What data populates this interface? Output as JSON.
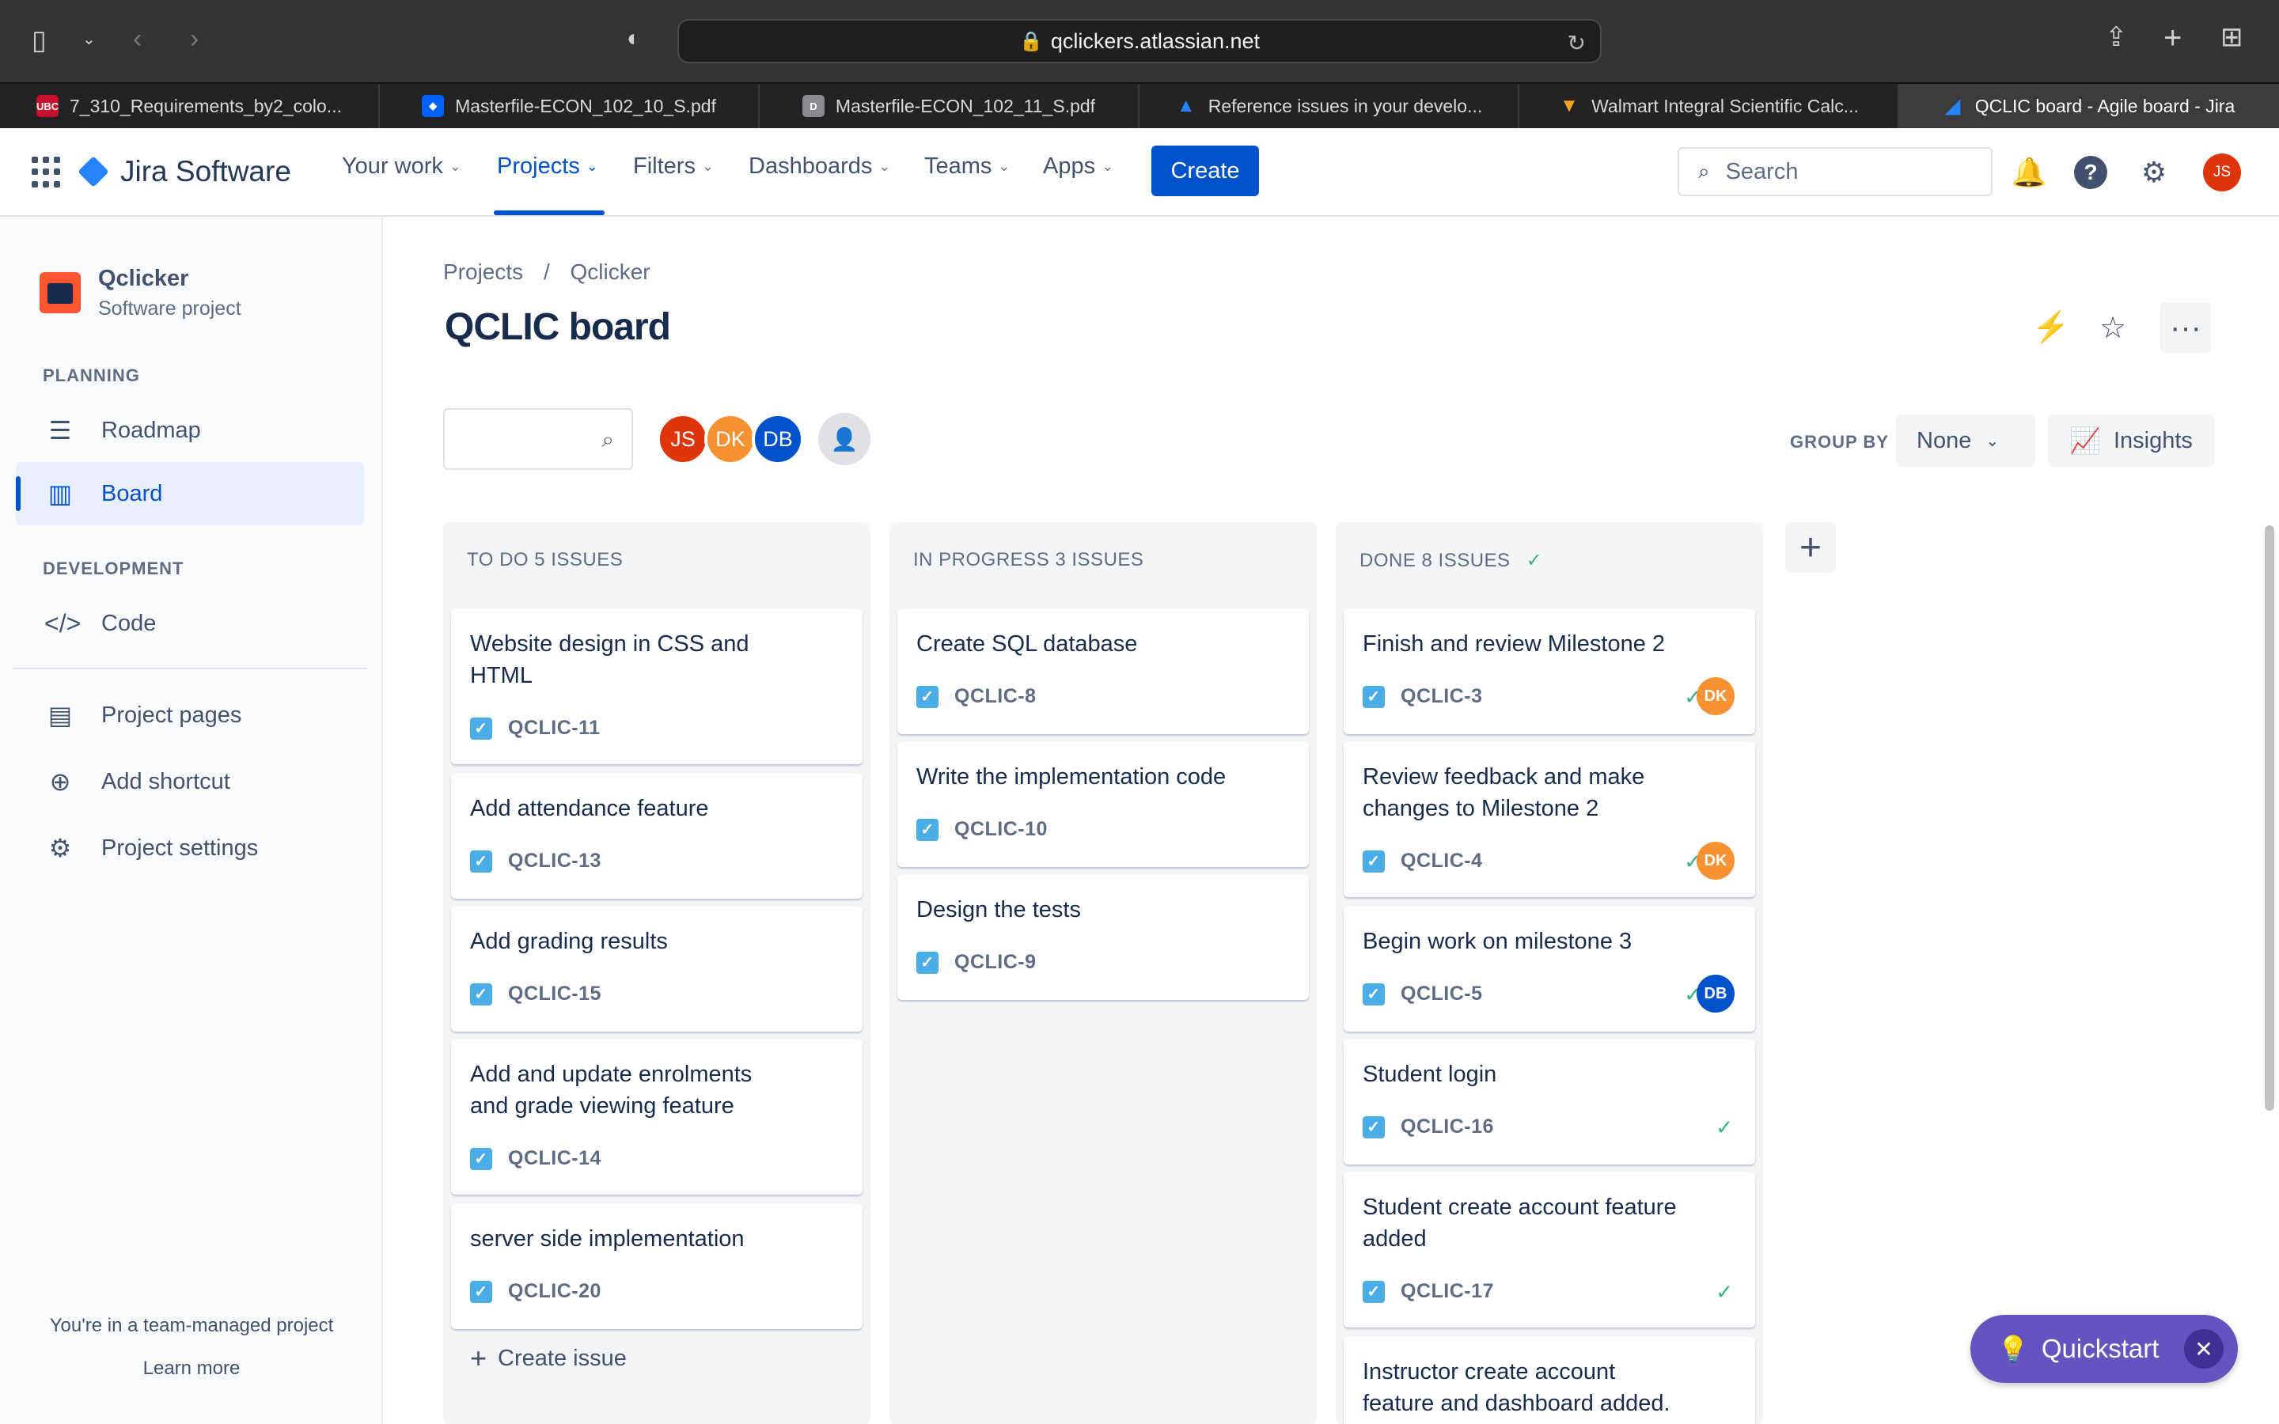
{
  "browser": {
    "url": "qclickers.atlassian.net",
    "tabs": [
      {
        "title": "7_310_Requirements_by2_colo...",
        "favicon": "UBC"
      },
      {
        "title": "Masterfile-ECON_102_10_S.pdf",
        "favicon": "dropbox"
      },
      {
        "title": "Masterfile-ECON_102_11_S.pdf",
        "favicon": "D"
      },
      {
        "title": "Reference issues in your develo...",
        "favicon": "atlassian"
      },
      {
        "title": "Walmart Integral Scientific Calc...",
        "favicon": "carrot"
      },
      {
        "title": "QCLIC board - Agile board - Jira",
        "favicon": "jira",
        "active": true
      }
    ]
  },
  "topnav": {
    "logo": "Jira Software",
    "items": [
      "Your work",
      "Projects",
      "Filters",
      "Dashboards",
      "Teams",
      "Apps"
    ],
    "create_label": "Create",
    "search_placeholder": "Search",
    "user_initials": "JS"
  },
  "sidebar": {
    "project_name": "Qclicker",
    "project_type": "Software project",
    "planning_label": "PLANNING",
    "development_label": "DEVELOPMENT",
    "items": {
      "roadmap": "Roadmap",
      "board": "Board",
      "code": "Code",
      "pages": "Project pages",
      "shortcut": "Add shortcut",
      "settings": "Project settings"
    },
    "footer_text": "You're in a team-managed project",
    "learn_more": "Learn more"
  },
  "board": {
    "breadcrumb": [
      "Projects",
      "/",
      "Qclicker"
    ],
    "title": "QCLIC board",
    "avatars": [
      {
        "initials": "JS",
        "color": "#de350b"
      },
      {
        "initials": "DK",
        "color": "#f79232"
      },
      {
        "initials": "DB",
        "color": "#0052cc"
      }
    ],
    "group_by_label": "GROUP BY",
    "group_by_value": "None",
    "insights_label": "Insights",
    "columns": [
      {
        "title": "TO DO 5 ISSUES",
        "done_check": false,
        "cards": [
          {
            "title": "Website design in CSS and HTML",
            "key": "QCLIC-11"
          },
          {
            "title": "Add attendance feature",
            "key": "QCLIC-13"
          },
          {
            "title": "Add grading results",
            "key": "QCLIC-15"
          },
          {
            "title": "Add and update enrolments and grade viewing feature",
            "key": "QCLIC-14"
          },
          {
            "title": "server side implementation",
            "key": "QCLIC-20"
          }
        ],
        "create_issue": "Create issue"
      },
      {
        "title": "IN PROGRESS 3 ISSUES",
        "done_check": false,
        "cards": [
          {
            "title": "Create SQL database",
            "key": "QCLIC-8"
          },
          {
            "title": "Write the implementation code",
            "key": "QCLIC-10"
          },
          {
            "title": "Design the tests",
            "key": "QCLIC-9"
          }
        ]
      },
      {
        "title": "DONE 8 ISSUES",
        "done_check": true,
        "cards": [
          {
            "title": "Finish and review Milestone 2",
            "key": "QCLIC-3",
            "assignee": "DK"
          },
          {
            "title": "Review feedback and make changes to Milestone 2",
            "key": "QCLIC-4",
            "assignee": "DK"
          },
          {
            "title": "Begin work on milestone 3",
            "key": "QCLIC-5",
            "assignee": "DB"
          },
          {
            "title": "Student login",
            "key": "QCLIC-16"
          },
          {
            "title": "Student create account feature added",
            "key": "QCLIC-17"
          },
          {
            "title": "Instructor create account feature and dashboard added."
          }
        ]
      }
    ]
  },
  "quickstart": {
    "label": "Quickstart"
  }
}
